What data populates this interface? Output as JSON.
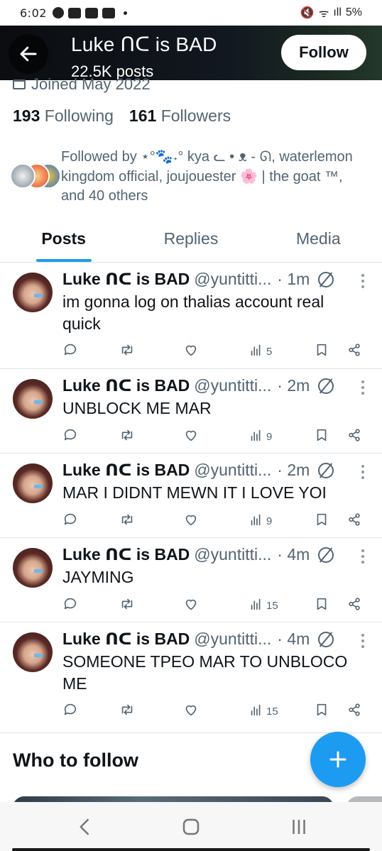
{
  "status_bar": {
    "time": "6:02",
    "battery": "5%"
  },
  "header": {
    "title": "Luke ᑎᑕ is BAD",
    "subtitle": "22.5K posts",
    "follow_label": "Follow"
  },
  "profile": {
    "joined": "Joined May 2022",
    "following_count": "193",
    "following_label": "Following",
    "followers_count": "161",
    "followers_label": "Followers",
    "followed_by_line1": "Followed by ⋆°🐾˖° kya ᓚ • ᴥ - ᘏ, waterlemon",
    "followed_by_line2": "kingdom official, joujouester 🌸 | the goat ™,",
    "followed_by_line3": "and 40 others"
  },
  "tabs": [
    {
      "label": "Posts"
    },
    {
      "label": "Replies"
    },
    {
      "label": "Media"
    }
  ],
  "posts": [
    {
      "name": "Luke ᑎᑕ is BAD",
      "handle": "@yuntitti...",
      "time": "· 1m",
      "text": "im gonna log on thalias account real quick",
      "views": "5"
    },
    {
      "name": "Luke ᑎᑕ is BAD",
      "handle": "@yuntitti...",
      "time": "· 2m",
      "text": "UNBLOCK ME MAR",
      "views": "9"
    },
    {
      "name": "Luke ᑎᑕ is BAD",
      "handle": "@yuntitti...",
      "time": "· 2m",
      "text": "MAR I DIDNT MEWN IT I LOVE YOI",
      "views": "9"
    },
    {
      "name": "Luke ᑎᑕ is BAD",
      "handle": "@yuntitti...",
      "time": "· 4m",
      "text": "JAYMING",
      "views": "15"
    },
    {
      "name": "Luke ᑎᑕ is BAD",
      "handle": "@yuntitti...",
      "time": "· 4m",
      "text": "SOMEONE TPEO MAR TO UNBLOCO ME",
      "views": "15"
    }
  ],
  "who_to_follow": {
    "title": "Who to follow"
  },
  "colors": {
    "accent": "#1d9bf0",
    "text": "#0f1419",
    "muted": "#536471"
  },
  "icons": [
    "back-arrow-icon",
    "calendar-icon",
    "reply-icon",
    "repost-icon",
    "like-icon",
    "views-icon",
    "bookmark-icon",
    "share-icon",
    "grok-icon",
    "more-icon",
    "compose-plus-icon"
  ]
}
